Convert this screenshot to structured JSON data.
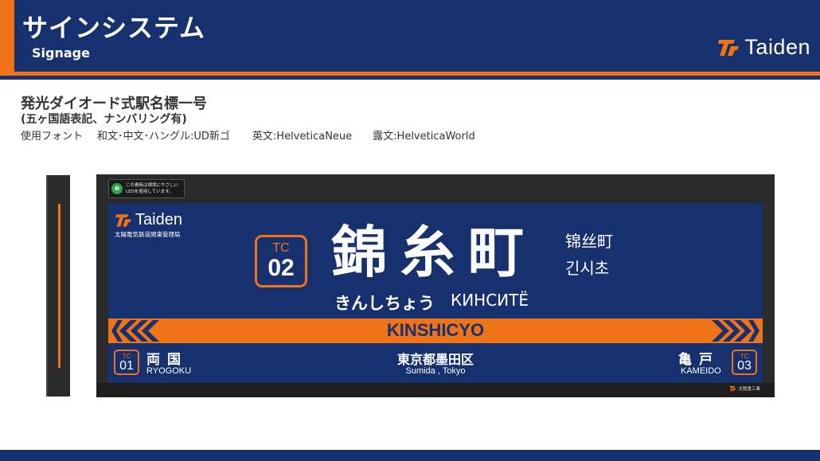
{
  "header": {
    "title": "サインシステム",
    "subtitle": "Signage",
    "brand": "Taiden"
  },
  "description": {
    "title": "発光ダイオード式駅名標一号",
    "subtitle": "(五ヶ国語表記、ナンバリング有)",
    "font_label": "使用フォント",
    "font_ja": "和文･中文･ハングル:UD新ゴ",
    "font_en": "英文:HelveticaNeue",
    "font_ru": "露文:HelveticaWorld"
  },
  "sign": {
    "eco_badge": [
      "この看板は環境にやさしい",
      "LEDを使用しています。"
    ],
    "operator_brand": "Taiden",
    "operator_name": "太陽電気鉄道関東管理局",
    "numbering": {
      "line": "TC",
      "code": "02"
    },
    "station": {
      "kanji": "錦糸町",
      "kana": "きんしちょう",
      "russian": "КИНСИТЁ",
      "chinese": "锦丝町",
      "korean": "긴시초",
      "romaji": "KINSHICYO"
    },
    "prev": {
      "line": "TC",
      "code": "01",
      "kanji": "両国",
      "romaji": "RYOGOKU"
    },
    "next": {
      "line": "TC",
      "code": "03",
      "kanji": "亀戸",
      "romaji": "KAMEIDO"
    },
    "location": {
      "ja": "東京都墨田区",
      "en": "Sumida , Tokyo"
    },
    "maker": "太陽重工業"
  },
  "colors": {
    "navy": "#17306e",
    "orange": "#f07318",
    "frame": "#2a2a2a",
    "eco_green": "#2ea44f"
  }
}
